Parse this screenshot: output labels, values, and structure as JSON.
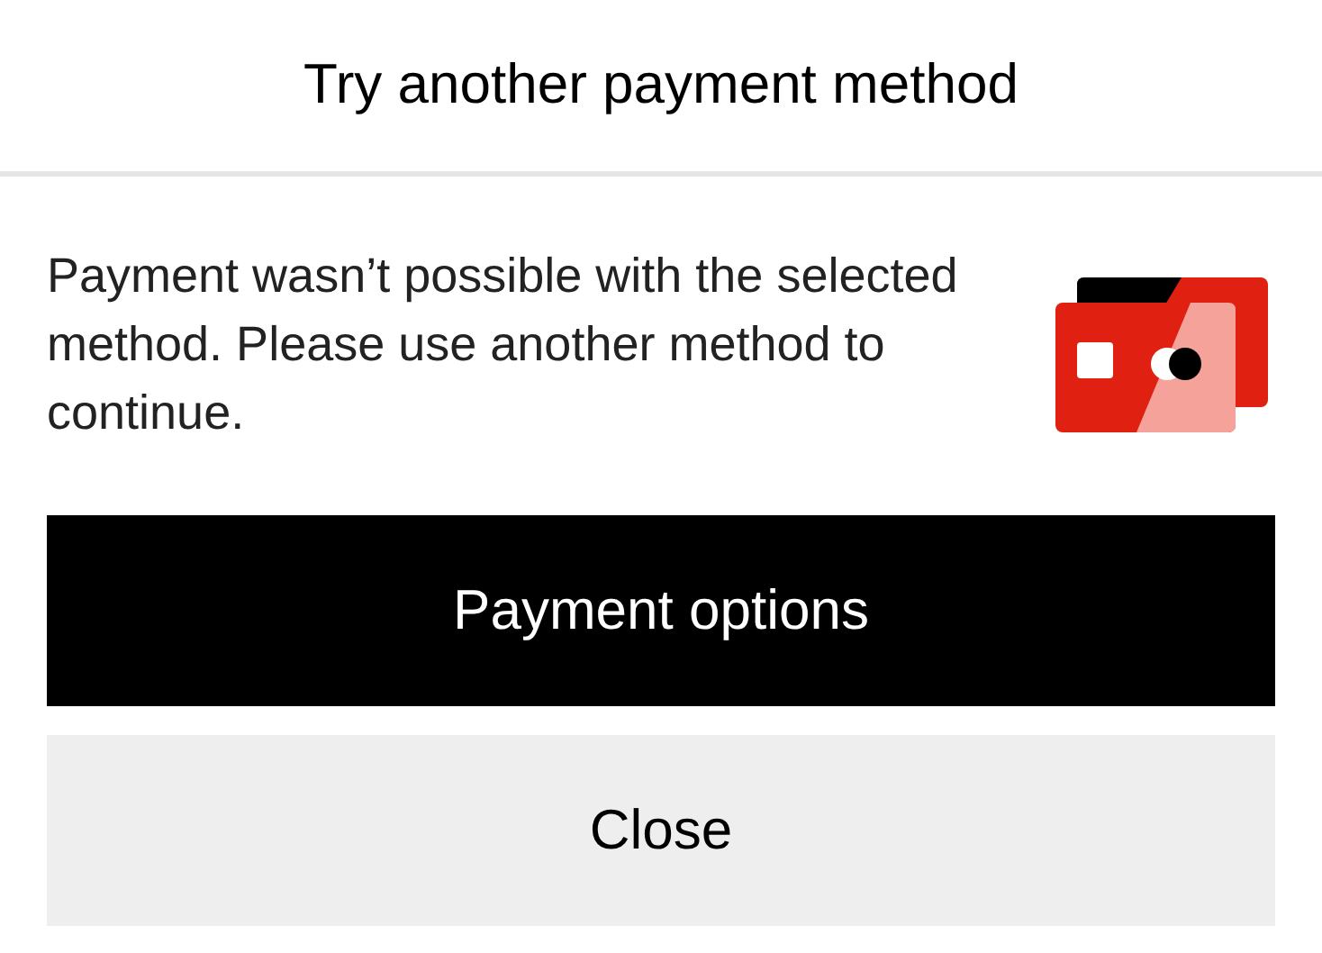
{
  "title": "Try another payment method",
  "message": "Payment wasn’t possible with the selected method. Please use another method to continue.",
  "buttons": [
    {
      "label": "Payment options",
      "kind": "primary"
    },
    {
      "label": "Close",
      "kind": "secondary"
    }
  ]
}
